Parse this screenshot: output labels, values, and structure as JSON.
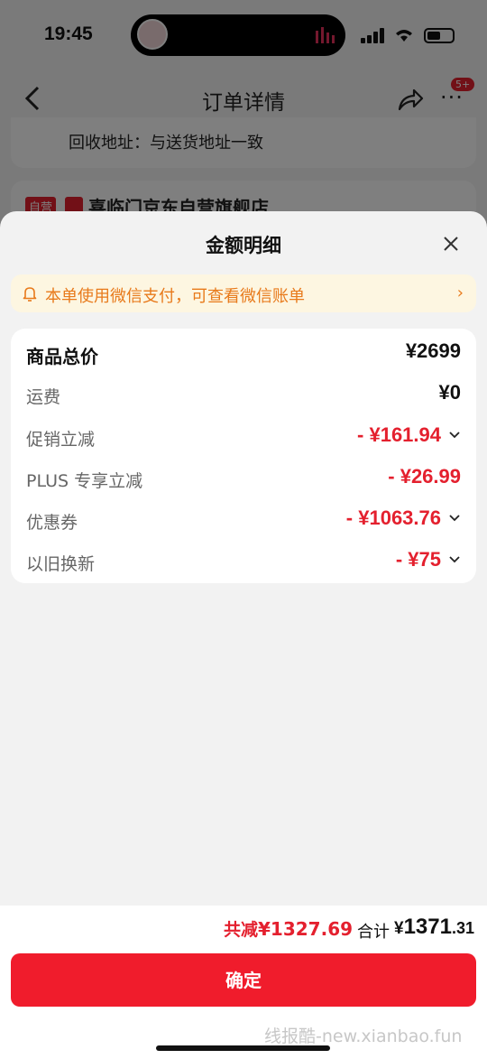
{
  "status_bar": {
    "time": "19:45"
  },
  "background_page": {
    "nav_title": "订单详情",
    "more_badge": "5+",
    "recycle_address": "回收地址：与送货地址一致",
    "store_tag": "自营",
    "store_name": "喜临门京东自营旗舰店"
  },
  "sheet": {
    "title": "金额明细",
    "notice": "本单使用微信支付，可查看微信账单",
    "rows": [
      {
        "label": "商品总价",
        "value": "¥2699"
      },
      {
        "label": "运费",
        "value": "¥0"
      },
      {
        "label": "促销立减",
        "value": "- ¥161.94"
      },
      {
        "label": "PLUS 专享立减",
        "value": "- ¥26.99"
      },
      {
        "label": "优惠券",
        "value": "- ¥1063.76"
      },
      {
        "label": "以旧换新",
        "value": "- ¥75"
      }
    ]
  },
  "footer": {
    "savings_label": "共减",
    "savings_value": "¥1327.69",
    "total_label": "合计",
    "total_currency": "¥",
    "total_integer": "1371",
    "total_decimal": ".31",
    "confirm_label": "确定"
  },
  "watermark": "线报酷-new.xianbao.fun",
  "colors": {
    "accent_red": "#f01c2c",
    "notice_orange": "#e87a1b",
    "notice_bg": "#fdf6e1"
  }
}
